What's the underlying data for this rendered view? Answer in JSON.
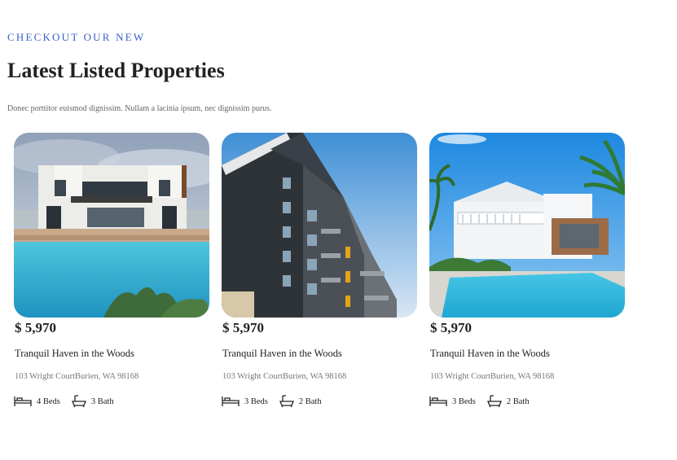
{
  "header": {
    "eyebrow": "CHECKOUT OUR NEW",
    "title": "Latest Listed Properties",
    "subtitle": "Donec porttitor euismod dignissim. Nullam a lacinia ipsum, nec dignissim purus."
  },
  "listings": [
    {
      "price": "$ 5,970",
      "name": "Tranquil Haven in the Woods",
      "address": "103 Wright CourtBurien, WA 98168",
      "beds": "4 Beds",
      "baths": "3 Bath"
    },
    {
      "price": "$ 5,970",
      "name": "Tranquil Haven in the Woods",
      "address": "103 Wright CourtBurien, WA 98168",
      "beds": "3 Beds",
      "baths": "2 Bath"
    },
    {
      "price": "$ 5,970",
      "name": "Tranquil Haven in the Woods",
      "address": "103 Wright CourtBurien, WA 98168",
      "beds": "3 Beds",
      "baths": "2 Bath"
    }
  ],
  "icons": {
    "beds": "bed-icon",
    "baths": "bathtub-icon"
  },
  "colors": {
    "eyebrow": "#3a5fc8",
    "pool": "#29b6d8",
    "sky": "#4aa3e0"
  }
}
